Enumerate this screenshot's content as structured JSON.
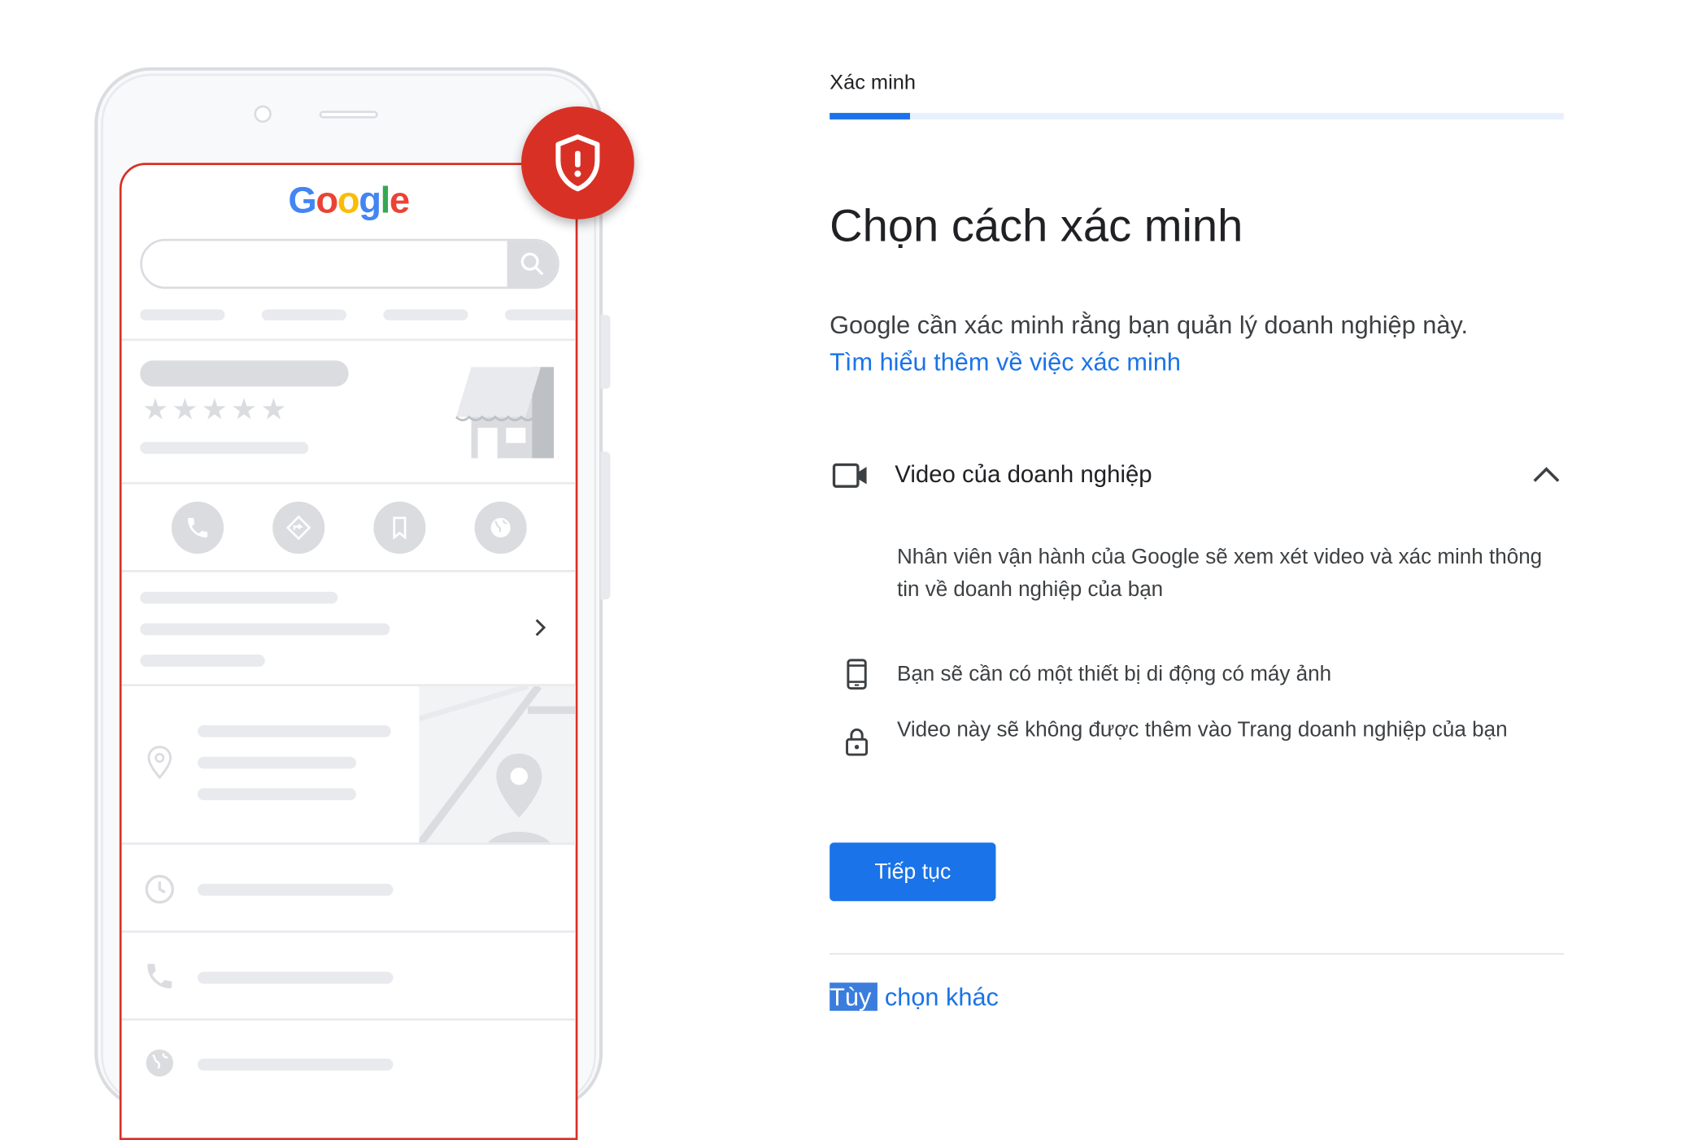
{
  "illustration": {
    "logo_letters": [
      {
        "ch": "G",
        "color": "#4285f4"
      },
      {
        "ch": "o",
        "color": "#ea4335"
      },
      {
        "ch": "o",
        "color": "#fbbc05"
      },
      {
        "ch": "g",
        "color": "#4285f4"
      },
      {
        "ch": "l",
        "color": "#34a853"
      },
      {
        "ch": "e",
        "color": "#ea4335"
      }
    ],
    "badge_icon": "shield-alert-icon",
    "badge_color": "#d93025",
    "rating_stars": "★★★★★"
  },
  "progress": {
    "step_label": "Xác minh",
    "fraction": 0.11
  },
  "main": {
    "title": "Chọn cách xác minh",
    "description": "Google cần xác minh rằng bạn quản lý doanh nghiệp này.",
    "learn_more_link": "Tìm hiểu thêm về việc xác minh"
  },
  "method": {
    "icon": "video-camera-icon",
    "title": "Video của doanh nghiệp",
    "expanded": true,
    "description": "Nhân viên vận hành của Google sẽ xem xét video và xác minh thông tin về doanh nghiệp của bạn",
    "requirements": [
      {
        "icon": "smartphone-icon",
        "text": "Bạn sẽ cần có một thiết bị di động có máy ảnh"
      },
      {
        "icon": "lock-icon",
        "text": "Video này sẽ không được thêm vào Trang doanh nghiệp của bạn"
      }
    ]
  },
  "actions": {
    "continue_label": "Tiếp tục",
    "other_options_selected": "Tùy",
    "other_options_rest": " chọn khác"
  },
  "colors": {
    "accent": "#1a73e8",
    "alert": "#d93025",
    "text_primary": "#202124",
    "text_secondary": "#3c4043"
  }
}
